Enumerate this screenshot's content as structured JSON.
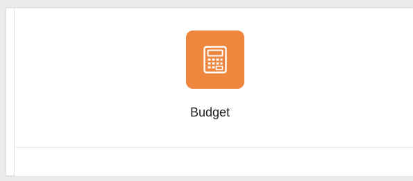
{
  "app_tile": {
    "label": "Budget",
    "icon": "calculator-icon",
    "icon_bg_color": "#ee863d",
    "icon_fg_color": "#ffffff"
  }
}
